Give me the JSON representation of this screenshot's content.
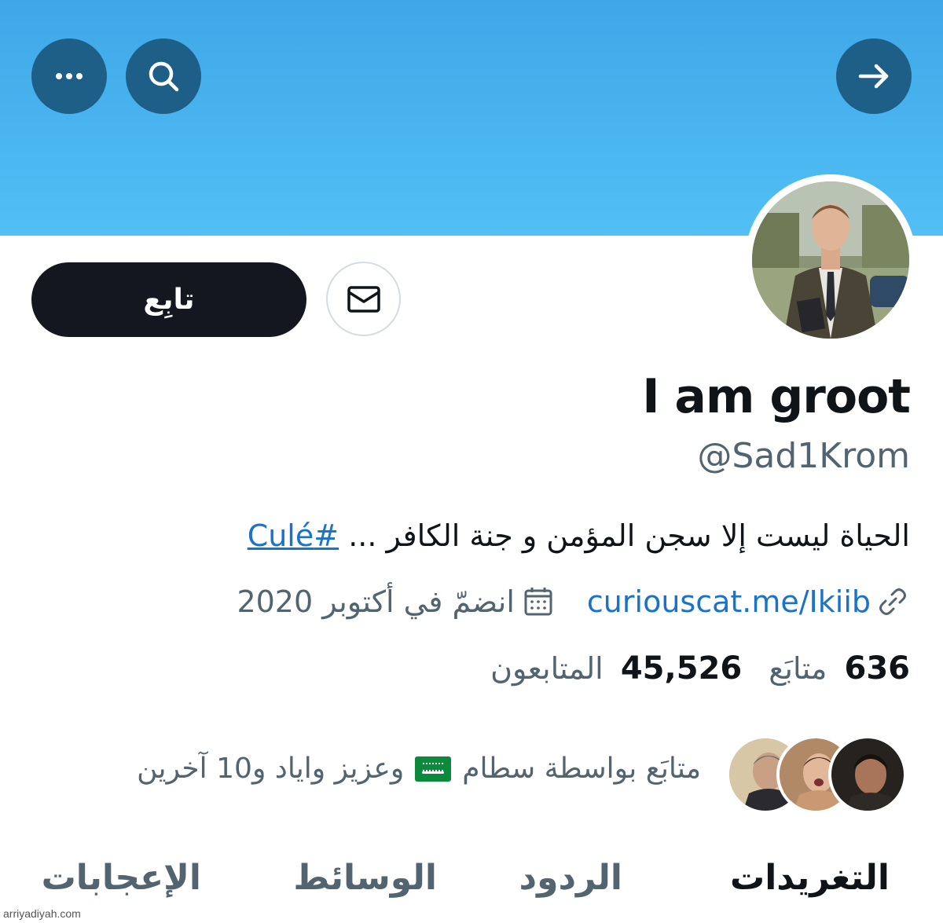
{
  "header": {
    "more_icon": "more-horizontal-icon",
    "search_icon": "search-icon",
    "forward_icon": "arrow-right-icon",
    "banner_color": "#47b3ef"
  },
  "profile": {
    "follow_label": "تابِع",
    "display_name": "I am groot",
    "handle": "@Sad1Krom",
    "bio_text": "الحياة ليست إلا سجن المؤمن و جنة الكافر ...",
    "bio_hashtag": "#Culé",
    "link": "curiouscat.me/Ikiib",
    "joined": "انضمّ في أكتوبر 2020"
  },
  "stats": {
    "following_count": "636",
    "following_label": "متابَع",
    "followers_count": "45,526",
    "followers_label": "المتابعون"
  },
  "followed_by": {
    "prefix": "متابَع بواسطة سطام",
    "suffix": "وعزيز واياد و10 آخرين"
  },
  "tabs": [
    {
      "label": "التغريدات",
      "active": true
    },
    {
      "label": "الردود",
      "active": false
    },
    {
      "label": "الوسائط",
      "active": false
    },
    {
      "label": "الإعجابات",
      "active": false
    }
  ],
  "watermark": "arriyadiyah.com"
}
